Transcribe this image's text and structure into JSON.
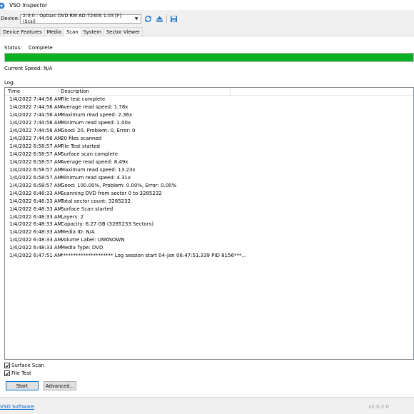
{
  "window": {
    "title": "VSO Inspector"
  },
  "toolbar": {
    "device_label": "Device:",
    "device_value": "2:0:0 - Optiarc DVD RW AD-7240S 1.03 [F] (Scsi)",
    "refresh_icon": "refresh-icon",
    "eject_icon": "eject-icon",
    "save_icon": "save-icon"
  },
  "tabs": [
    "Device Features",
    "Media",
    "Scan",
    "System",
    "Sector Viewer"
  ],
  "active_tab": "Scan",
  "scan": {
    "status_label": "Status:",
    "status_value": "Complete",
    "progress_percent": 100,
    "progress_color": "#06b025",
    "speed_text": "Current Speed: N/A",
    "log_label": "Log:"
  },
  "log": {
    "columns": {
      "time": "Time",
      "description": "Description"
    },
    "rows": [
      {
        "time": "1/4/2022 7:44:56 AM",
        "desc": "File test complete"
      },
      {
        "time": "1/4/2022 7:44:56 AM",
        "desc": "Average read speed: 1.78x"
      },
      {
        "time": "1/4/2022 7:44:56 AM",
        "desc": "Maximum read speed: 2.36x"
      },
      {
        "time": "1/4/2022 7:44:56 AM",
        "desc": "Minimum read speed: 1.00x"
      },
      {
        "time": "1/4/2022 7:44:56 AM",
        "desc": "Good: 20, Problem: 0, Error: 0"
      },
      {
        "time": "1/4/2022 7:44:56 AM",
        "desc": "20 files scanned"
      },
      {
        "time": "1/4/2022 6:58:57 AM",
        "desc": "File Test started"
      },
      {
        "time": "1/4/2022 6:58:57 AM",
        "desc": "Surface scan complete"
      },
      {
        "time": "1/4/2022 6:58:57 AM",
        "desc": "Average read speed: 8.49x"
      },
      {
        "time": "1/4/2022 6:58:57 AM",
        "desc": "Maximum read speed: 13.23x"
      },
      {
        "time": "1/4/2022 6:58:57 AM",
        "desc": "Minimum read speed: 4.31x"
      },
      {
        "time": "1/4/2022 6:58:57 AM",
        "desc": "Good: 100.00%, Problem: 0.00%, Error: 0.00%"
      },
      {
        "time": "1/4/2022 6:48:33 AM",
        "desc": "Scanning DVD from sector 0 to 3285232"
      },
      {
        "time": "1/4/2022 6:48:33 AM",
        "desc": "Total sector count: 3285232"
      },
      {
        "time": "1/4/2022 6:48:33 AM",
        "desc": "Surface Scan started"
      },
      {
        "time": "1/4/2022 6:48:33 AM",
        "desc": "Layers: 2"
      },
      {
        "time": "1/4/2022 6:48:33 AM",
        "desc": "Capacity: 6.27 GB (3285233 Sectors)"
      },
      {
        "time": "1/4/2022 6:48:33 AM",
        "desc": "Media ID: N/A"
      },
      {
        "time": "1/4/2022 6:48:33 AM",
        "desc": "Volume Label: UNKNOWN"
      },
      {
        "time": "1/4/2022 6:48:33 AM",
        "desc": "Media Type: DVD"
      },
      {
        "time": "1/4/2022 6:47:51 AM",
        "desc": "********************* Log session start 04-Jan 06:47:51.339 PID 8156***..."
      }
    ]
  },
  "options": {
    "surface_scan_label": "Surface Scan",
    "surface_scan_checked": true,
    "file_test_label": "File Test",
    "file_test_checked": true
  },
  "buttons": {
    "start": "Start",
    "advanced": "Advanced..."
  },
  "footer": {
    "link": "VSO Software",
    "version": "v2.0.2.0"
  }
}
